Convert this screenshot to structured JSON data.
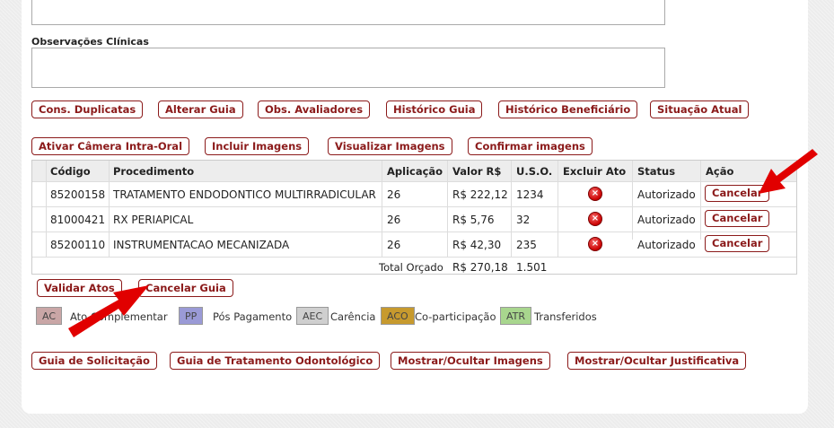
{
  "clinical_notes_label": "Observações Clínicas",
  "toolbar1": {
    "cons_duplicatas": "Cons. Duplicatas",
    "alterar_guia": "Alterar Guia",
    "obs_avaliadores": "Obs. Avaliadores",
    "historico_guia": "Histórico Guia",
    "historico_beneficiario": "Histórico Beneficiário",
    "situacao_atual": "Situação Atual"
  },
  "toolbar2": {
    "ativar_camera": "Ativar Câmera Intra-Oral",
    "incluir_imagens": "Incluir Imagens",
    "visualizar_imagens": "Visualizar Imagens",
    "confirmar_imagens": "Confirmar imagens"
  },
  "table": {
    "headers": [
      "Código",
      "Procedimento",
      "Aplicação",
      "Valor R$",
      "U.S.O.",
      "Excluir Ato",
      "Status",
      "Ação"
    ],
    "rows": [
      {
        "codigo": "85200158",
        "procedimento": "TRATAMENTO ENDODONTICO MULTIRRADICULAR",
        "aplicacao": "26",
        "valor": "R$ 222,12",
        "uso": "1234",
        "status": "Autorizado",
        "acao": "Cancelar"
      },
      {
        "codigo": "81000421",
        "procedimento": "RX PERIAPICAL",
        "aplicacao": "26",
        "valor": "R$ 5,76",
        "uso": "32",
        "status": "Autorizado",
        "acao": "Cancelar"
      },
      {
        "codigo": "85200110",
        "procedimento": "INSTRUMENTACAO MECANIZADA",
        "aplicacao": "26",
        "valor": "R$ 42,30",
        "uso": "235",
        "status": "Autorizado",
        "acao": "Cancelar"
      }
    ],
    "total_label": "Total Orçado",
    "total_valor": "R$ 270,18",
    "total_uso": "1.501"
  },
  "actions": {
    "validar_atos": "Validar Atos",
    "cancelar_guia": "Cancelar Guia"
  },
  "legend": [
    {
      "code": "AC",
      "label": "Ato Complementar",
      "color": "#c9a6a6"
    },
    {
      "code": "PP",
      "label": "Pós Pagamento",
      "color": "#9a9ad6"
    },
    {
      "code": "AEC",
      "label": "Carência",
      "color": "#cfcfcf"
    },
    {
      "code": "ACO",
      "label": "Co-participação",
      "color": "#c79a2e"
    },
    {
      "code": "ATR",
      "label": "Transferidos",
      "color": "#a8d68e"
    }
  ],
  "footer": {
    "guia_solicitacao": "Guia de Solicitação",
    "guia_tratamento": "Guia de Tratamento Odontológico",
    "mostrar_imagens": "Mostrar/Ocultar Imagens",
    "mostrar_justificativa": "Mostrar/Ocultar Justificativa"
  },
  "icons": {
    "delete": "x-circle-icon",
    "annotation": "red-arrow-icon"
  },
  "colors": {
    "accent": "#8b1a1a",
    "arrow": "#e10000",
    "header_bg": "#ededed"
  }
}
